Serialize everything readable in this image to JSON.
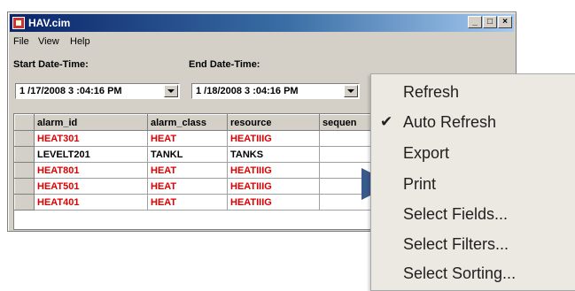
{
  "window": {
    "title": "HAV.cim",
    "minimize": "_",
    "maximize": "□",
    "close": "×"
  },
  "menu": {
    "file": "File",
    "view": "View",
    "help": "Help"
  },
  "dates": {
    "start_label": "Start Date-Time:",
    "start_value": "1 /17/2008  3 :04:16 PM",
    "end_label": "End Date-Time:",
    "end_value": "1 /18/2008  3 :04:16 PM"
  },
  "table": {
    "columns": [
      "alarm_id",
      "alarm_class",
      "resource",
      "sequen"
    ],
    "rows": [
      [
        "HEAT301",
        "HEAT",
        "HEATIIIG"
      ],
      [
        "LEVELT201",
        "TANKL",
        "TANKS"
      ],
      [
        "HEAT801",
        "HEAT",
        "HEATIIIG"
      ],
      [
        "HEAT501",
        "HEAT",
        "HEATIIIG"
      ],
      [
        "HEAT401",
        "HEAT",
        "HEATIIIG"
      ]
    ]
  },
  "context_menu": {
    "items": [
      "Refresh",
      "Auto Refresh",
      "Export",
      "Print",
      "Select Fields...",
      "Select Filters...",
      "Select Sorting..."
    ],
    "checked": "Auto Refresh",
    "pointed_item": "Print"
  },
  "colors": {
    "title_gradient_start": "#0a246a",
    "alarm_red": "#e00000",
    "pointer_blue": "#3b5a8c"
  },
  "icons": {
    "check": "checkmark-icon",
    "pointer": "arrow-pointer-icon",
    "app": "app-icon"
  }
}
